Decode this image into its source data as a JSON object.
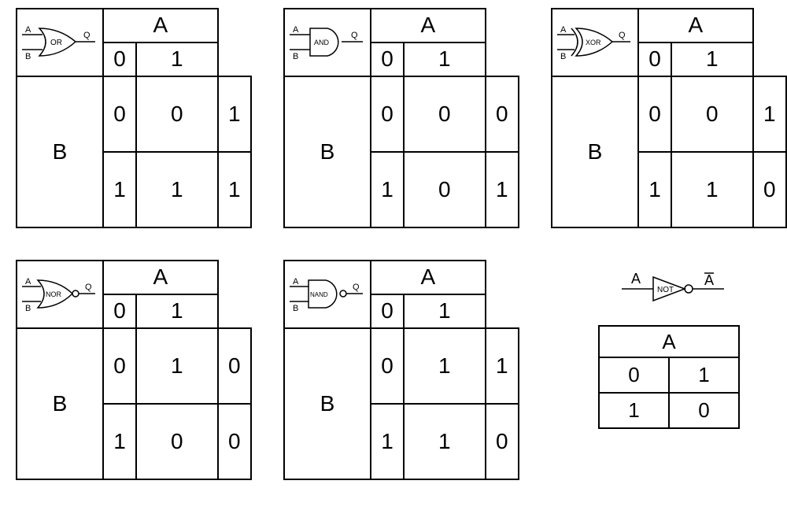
{
  "common": {
    "A": "A",
    "B": "B",
    "Q": "Q",
    "zero": "0",
    "one": "1",
    "Abar": "A̅"
  },
  "gates": {
    "or": {
      "label": "OR",
      "q00": "0",
      "q01": "1",
      "q10": "1",
      "q11": "1"
    },
    "and": {
      "label": "AND",
      "q00": "0",
      "q01": "0",
      "q10": "0",
      "q11": "1"
    },
    "xor": {
      "label": "XOR",
      "q00": "0",
      "q01": "1",
      "q10": "1",
      "q11": "0"
    },
    "nor": {
      "label": "NOR",
      "q00": "1",
      "q01": "0",
      "q10": "0",
      "q11": "0"
    },
    "nand": {
      "label": "NAND",
      "q00": "1",
      "q01": "1",
      "q10": "1",
      "q11": "0"
    },
    "not": {
      "label": "NOT",
      "q0": "1",
      "q1": "0"
    }
  },
  "chart_data": [
    {
      "type": "table",
      "title": "OR",
      "columns": [
        "B",
        "A",
        "Q"
      ],
      "rows": [
        [
          0,
          0,
          0
        ],
        [
          0,
          1,
          1
        ],
        [
          1,
          0,
          1
        ],
        [
          1,
          1,
          1
        ]
      ]
    },
    {
      "type": "table",
      "title": "AND",
      "columns": [
        "B",
        "A",
        "Q"
      ],
      "rows": [
        [
          0,
          0,
          0
        ],
        [
          0,
          1,
          0
        ],
        [
          1,
          0,
          0
        ],
        [
          1,
          1,
          1
        ]
      ]
    },
    {
      "type": "table",
      "title": "XOR",
      "columns": [
        "B",
        "A",
        "Q"
      ],
      "rows": [
        [
          0,
          0,
          0
        ],
        [
          0,
          1,
          1
        ],
        [
          1,
          0,
          1
        ],
        [
          1,
          1,
          0
        ]
      ]
    },
    {
      "type": "table",
      "title": "NOR",
      "columns": [
        "B",
        "A",
        "Q"
      ],
      "rows": [
        [
          0,
          0,
          1
        ],
        [
          0,
          1,
          0
        ],
        [
          1,
          0,
          0
        ],
        [
          1,
          1,
          0
        ]
      ]
    },
    {
      "type": "table",
      "title": "NAND",
      "columns": [
        "B",
        "A",
        "Q"
      ],
      "rows": [
        [
          0,
          0,
          1
        ],
        [
          0,
          1,
          1
        ],
        [
          1,
          0,
          1
        ],
        [
          1,
          1,
          0
        ]
      ]
    },
    {
      "type": "table",
      "title": "NOT",
      "columns": [
        "A",
        "Q"
      ],
      "rows": [
        [
          0,
          1
        ],
        [
          1,
          0
        ]
      ]
    }
  ]
}
